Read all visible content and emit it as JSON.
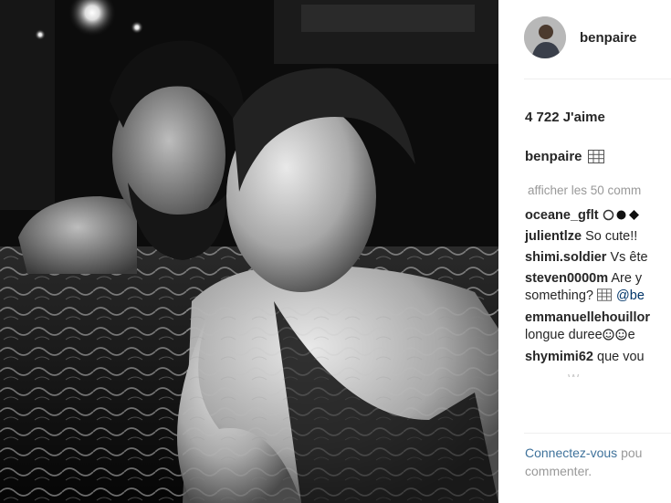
{
  "post": {
    "username": "benpaire",
    "likes": "4 722 J'aime",
    "caption_icon": "grid-emoji-icon",
    "load_more": "afficher les 50 comm",
    "comments": [
      {
        "user": "oceane_gflt",
        "text": "",
        "icons": [
          "circle-outline-icon",
          "circle-filled-icon",
          "diamond-icon"
        ]
      },
      {
        "user": "julientlze",
        "text": "So cute!!"
      },
      {
        "user": "shimi.soldier",
        "text": "Vs ête"
      },
      {
        "user": "steven0000m",
        "text": "Are y",
        "line2": "something?",
        "line2_icon": "grid-emoji-icon",
        "mention": "@be"
      },
      {
        "user": "emmanuellehouillor",
        "text": "",
        "line2": "longue duree",
        "line2_icons": [
          "smile-emoji-icon",
          "smile-emoji-icon"
        ],
        "line2_tail": "e"
      },
      {
        "user": "shymimi62",
        "text": "que vou"
      }
    ],
    "faded_comment": "............ W...",
    "login_link": "Connectez-vous",
    "login_rest": "pou",
    "login_line2": "commenter."
  },
  "colors": {
    "username": "#262626",
    "muted": "#999999",
    "link": "#3f729b",
    "mention": "#003569"
  }
}
